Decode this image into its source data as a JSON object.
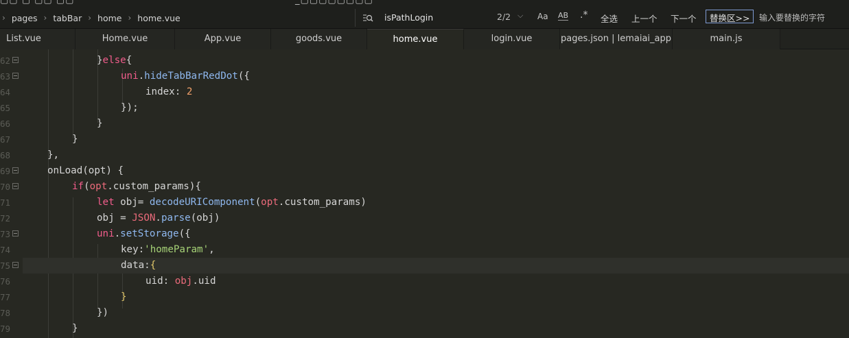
{
  "topbar": {
    "clipped_text_left": "▢▢ ▢ ▢▢ ▢▢",
    "clipped_text_mid": "_▢▢▢▢▢▢▢▢",
    "breadcrumb": [
      "pages",
      "tabBar",
      "home",
      "home.vue"
    ],
    "search_value": "isPathLogin",
    "match_count": "2/2",
    "case_toggle_label": "Aa",
    "word_toggle_label": "AB",
    "regex_toggle_label": ".*",
    "select_all_label": "全选",
    "prev_label": "上一个",
    "next_label": "下一个",
    "replace_toggle_label": "替换区>>",
    "replace_placeholder": "输入要替换的字符"
  },
  "tabs": [
    {
      "label": "List.vue",
      "active": false
    },
    {
      "label": "Home.vue",
      "active": false
    },
    {
      "label": "App.vue",
      "active": false
    },
    {
      "label": "goods.vue",
      "active": false
    },
    {
      "label": "home.vue",
      "active": true
    },
    {
      "label": "login.vue",
      "active": false
    },
    {
      "label": "pages.json | lemaiai_app",
      "active": false
    },
    {
      "label": "main.js",
      "active": false
    }
  ],
  "editor": {
    "current_line": "75",
    "lines": [
      {
        "no": "62",
        "fold": true
      },
      {
        "no": "63",
        "fold": true
      },
      {
        "no": "64",
        "fold": false
      },
      {
        "no": "65",
        "fold": false
      },
      {
        "no": "66",
        "fold": false
      },
      {
        "no": "67",
        "fold": false
      },
      {
        "no": "68",
        "fold": false
      },
      {
        "no": "69",
        "fold": true
      },
      {
        "no": "70",
        "fold": true
      },
      {
        "no": "71",
        "fold": false
      },
      {
        "no": "72",
        "fold": false
      },
      {
        "no": "73",
        "fold": true
      },
      {
        "no": "74",
        "fold": false
      },
      {
        "no": "75",
        "fold": true
      },
      {
        "no": "76",
        "fold": false
      },
      {
        "no": "77",
        "fold": false
      },
      {
        "no": "78",
        "fold": false
      },
      {
        "no": "79",
        "fold": false
      }
    ],
    "tokens": {
      "l62_close": "}",
      "l62_else": "else",
      "l62_open": "{",
      "l63_uni": "uni",
      "l63_dot": ".",
      "l63_fn": "hideTabBarRedDot",
      "l63_rest": "({",
      "l64_key": "index",
      "l64_colon": ": ",
      "l64_val": "2",
      "l65": "});",
      "l66": "}",
      "l67": "}",
      "l68": "},",
      "l69_fn": "onLoad",
      "l69_rest": "(opt) {",
      "l70_kw": "if",
      "l70_p1": "(",
      "l70_obj": "opt",
      "l70_rest": ".custom_params){",
      "l71_kw": "let",
      "l71_var": " obj= ",
      "l71_fn": "decodeURIComponent",
      "l71_p1": "(",
      "l71_obj": "opt",
      "l71_rest": ".custom_params)",
      "l72_var": "obj = ",
      "l72_obj": "JSON",
      "l72_dot": ".",
      "l72_fn": "parse",
      "l72_rest": "(obj)",
      "l73_uni": "uni",
      "l73_dot": ".",
      "l73_fn": "setStorage",
      "l73_rest": "({",
      "l74_key": "key",
      "l74_colon": ":",
      "l74_str": "'homeParam'",
      "l74_comma": ",",
      "l75_key": "data",
      "l75_colon": ":",
      "l75_brace": "{",
      "l76_key": "uid",
      "l76_colon": ": ",
      "l76_obj": "obj",
      "l76_rest": ".uid",
      "l77_brace": "}",
      "l78": "})",
      "l79": "}"
    }
  },
  "colors": {
    "background": "#272822",
    "keyword": "#f25d8c",
    "function": "#8fb8ef",
    "number": "#f0a06a",
    "string": "#a6d277",
    "object": "#ec6b7b",
    "brace_match": "#e2c86a"
  }
}
